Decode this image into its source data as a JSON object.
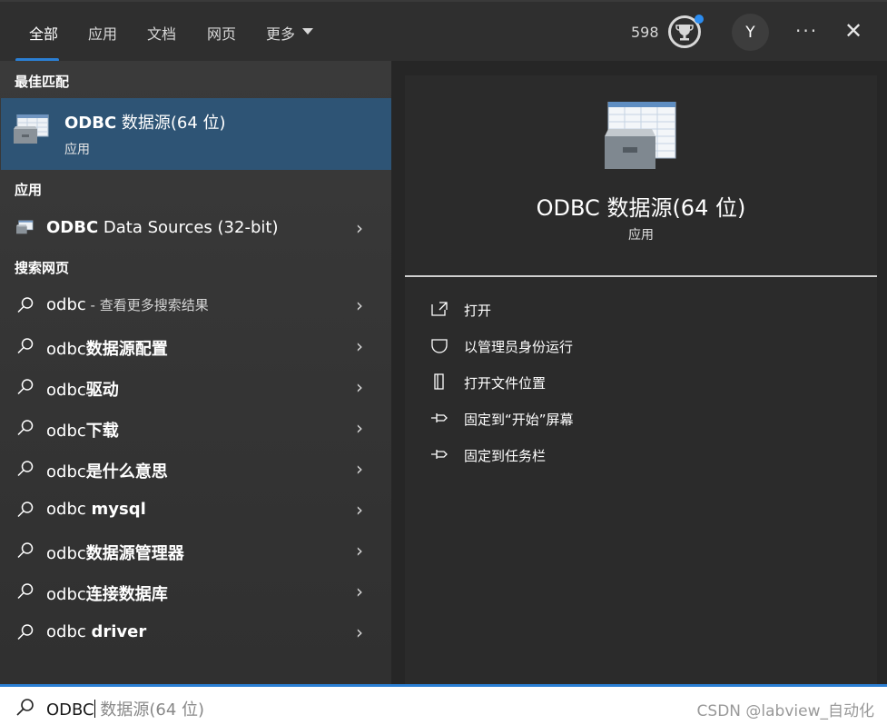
{
  "tabs": [
    {
      "label": "全部",
      "active": true
    },
    {
      "label": "应用"
    },
    {
      "label": "文档"
    },
    {
      "label": "网页"
    },
    {
      "label": "更多"
    }
  ],
  "header": {
    "points": "598",
    "avatar_letter": "Y",
    "more_icon": "ellipsis-icon",
    "close_icon": "close-icon"
  },
  "left": {
    "best_match_heading": "最佳匹配",
    "best": {
      "name_bold": "ODBC",
      "name_rest": " 数据源(64 位)",
      "type": "应用"
    },
    "apps_heading": "应用",
    "app_item": {
      "bold": "ODBC",
      "rest": " Data Sources (32-bit)"
    },
    "web_heading": "搜索网页",
    "web_items": [
      {
        "plain": "odbc",
        "bold": "",
        "hint": " - 查看更多搜索结果"
      },
      {
        "plain": "odbc",
        "bold": "数据源配置",
        "hint": ""
      },
      {
        "plain": "odbc",
        "bold": "驱动",
        "hint": ""
      },
      {
        "plain": "odbc",
        "bold": "下载",
        "hint": ""
      },
      {
        "plain": "odbc",
        "bold": "是什么意思",
        "hint": ""
      },
      {
        "plain": "odbc ",
        "bold": "mysql",
        "hint": ""
      },
      {
        "plain": "odbc",
        "bold": "数据源管理器",
        "hint": ""
      },
      {
        "plain": "odbc",
        "bold": "连接数据库",
        "hint": ""
      },
      {
        "plain": "odbc ",
        "bold": "driver",
        "hint": ""
      }
    ]
  },
  "detail": {
    "title": "ODBC 数据源(64 位)",
    "subtitle": "应用",
    "actions": [
      {
        "label": "打开",
        "icon": "open-icon"
      },
      {
        "label": "以管理员身份运行",
        "icon": "shield-icon"
      },
      {
        "label": "打开文件位置",
        "icon": "folder-location-icon"
      },
      {
        "label": "固定到“开始”屏幕",
        "icon": "pin-icon"
      },
      {
        "label": "固定到任务栏",
        "icon": "pin-icon"
      }
    ]
  },
  "search": {
    "typed": "ODBC",
    "suggestion": " 数据源(64 位)"
  },
  "watermark": "CSDN @labview_自动化"
}
